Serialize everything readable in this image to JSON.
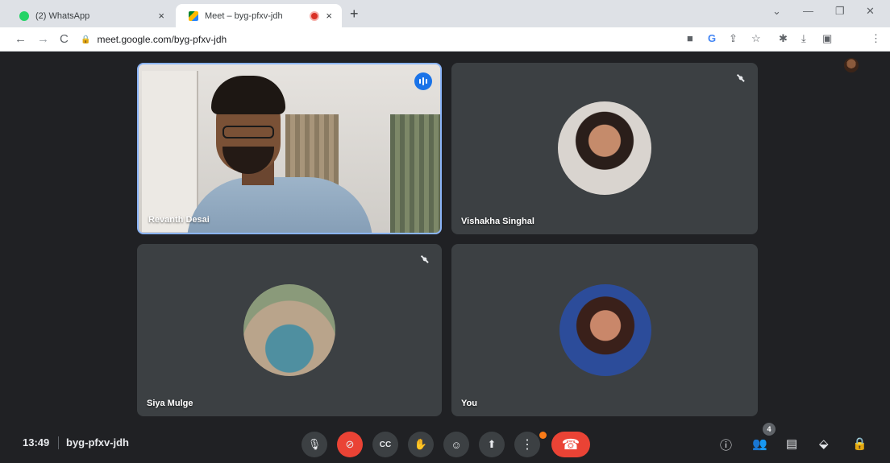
{
  "browser": {
    "tabs": [
      {
        "title": "(2) WhatsApp",
        "close": "×"
      },
      {
        "title": "Meet – byg-pfxv-jdh",
        "close": "×"
      }
    ],
    "new_tab": "+",
    "window_controls": {
      "minimize": "—",
      "restore": "❐",
      "close": "✕",
      "dropdown": "⌄"
    },
    "nav": {
      "back": "←",
      "forward": "→",
      "reload": "C"
    },
    "url": "meet.google.com/byg-pfxv-jdh",
    "toolbar_icons": [
      "camera-icon",
      "google-icon",
      "share-icon",
      "star-icon",
      "extensions-icon",
      "download-icon",
      "sidepanel-icon",
      "profile-avatar",
      "menu-icon"
    ]
  },
  "meeting": {
    "participants": [
      {
        "name": "Revanth Desai",
        "muted": false,
        "speaking": true,
        "video": true
      },
      {
        "name": "Vishakha Singhal",
        "muted": true,
        "video": false
      },
      {
        "name": "Siya Mulge",
        "muted": true,
        "video": false
      },
      {
        "name": "You",
        "muted": false,
        "video": false
      }
    ]
  },
  "bottom_bar": {
    "time": "13:49",
    "meeting_code": "byg-pfxv-jdh",
    "participant_count": "4",
    "controls": [
      "mic-icon",
      "camera-off-icon",
      "captions-icon",
      "raise-hand-icon",
      "emoji-icon",
      "present-icon",
      "more-options-icon",
      "end-call-icon"
    ],
    "right_controls": [
      "info-icon",
      "people-icon",
      "chat-icon",
      "activities-icon",
      "host-controls-icon"
    ]
  },
  "colors": {
    "accent": "#8ab4f8",
    "end_call": "#ea4335",
    "stage": "#202124",
    "tile": "#3c4043"
  }
}
